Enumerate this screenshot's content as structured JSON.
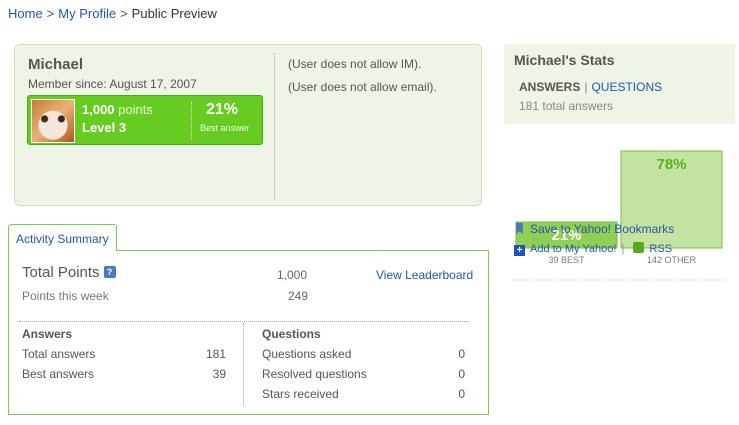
{
  "breadcrumb": {
    "home": "Home",
    "my_profile": "My Profile",
    "current": "Public Preview",
    "separator": ">"
  },
  "profile": {
    "name": "Michael",
    "member_since": "Member since: August 17, 2007",
    "points_value": "1,000",
    "points_label": "points",
    "level": "Level 3",
    "best_answer_pct": "21%",
    "best_answer_label": "Best answer",
    "im_note": "(User does not allow IM).",
    "email_note": "(User does not allow email)."
  },
  "activity": {
    "tab_label": "Activity Summary",
    "total_points_label": "Total Points",
    "help_icon_glyph": "?",
    "total_points_value": "1,000",
    "view_leaderboard": "View Leaderboard",
    "week_label": "Points this week",
    "week_value": "249",
    "answers": {
      "heading": "Answers",
      "rows": [
        {
          "label": "Total answers",
          "value": "181"
        },
        {
          "label": "Best answers",
          "value": "39"
        }
      ]
    },
    "questions": {
      "heading": "Questions",
      "rows": [
        {
          "label": "Questions asked",
          "value": "0"
        },
        {
          "label": "Resolved questions",
          "value": "0"
        },
        {
          "label": "Stars received",
          "value": "0"
        }
      ]
    }
  },
  "stats": {
    "title": "Michael's Stats",
    "tab_answers": "ANSWERS",
    "tab_separator": "|",
    "tab_questions": "QUESTIONS",
    "total_answers_note": "181 total answers",
    "save_bookmarks": "Save to Yahoo! Bookmarks",
    "add_my_yahoo": "Add to My Yahoo!",
    "pipe": "|",
    "rss": "RSS"
  },
  "chart_data": {
    "type": "bar",
    "categories": [
      "39 BEST",
      "142 OTHER"
    ],
    "values": [
      21,
      78
    ],
    "data_labels": [
      "21%",
      "78%"
    ],
    "colors": [
      "#8fcf55",
      "#c4e3a0"
    ],
    "label_colors": [
      "#ffffff",
      "#5aae22"
    ],
    "ylim": [
      0,
      100
    ]
  },
  "colors": {
    "accent_green": "#66cc22",
    "link_blue": "#2255aa",
    "panel_bg": "#eef5e6"
  }
}
